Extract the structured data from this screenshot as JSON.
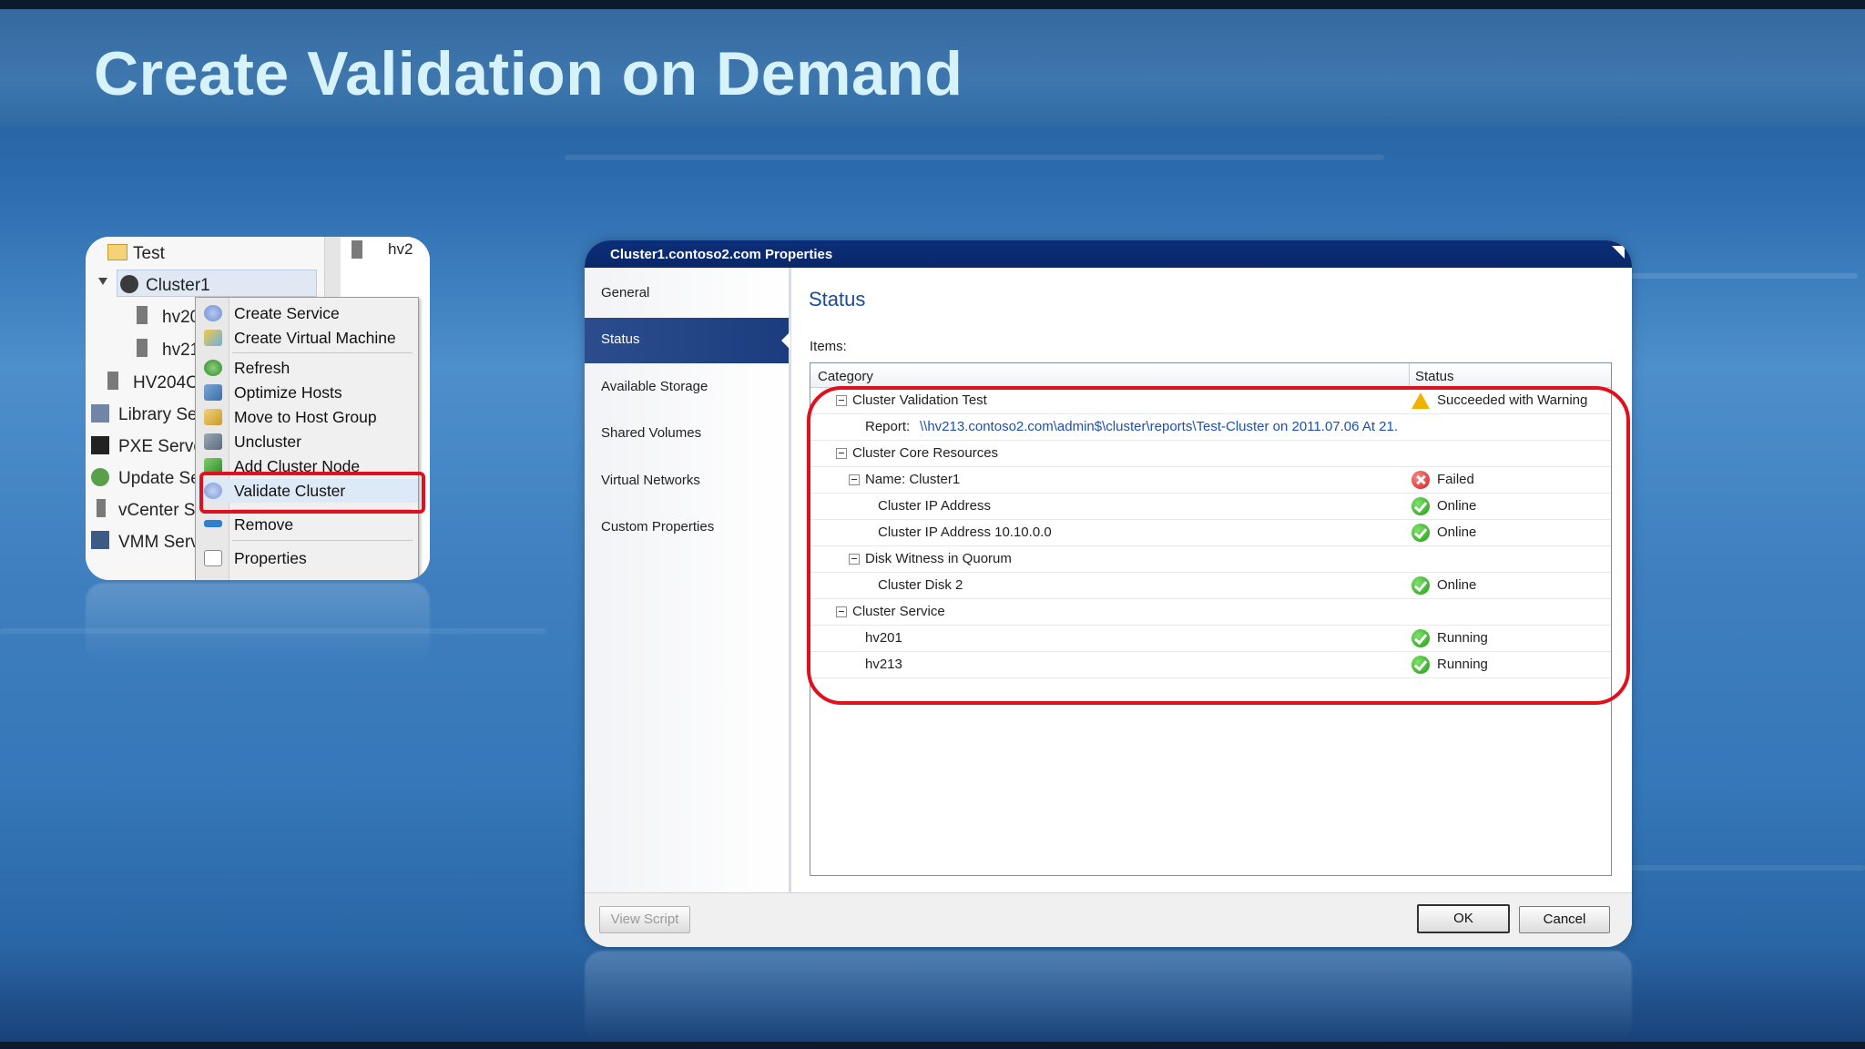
{
  "slide": {
    "title": "Create Validation on Demand"
  },
  "tree": {
    "items": [
      {
        "label": "Test"
      },
      {
        "label": "Cluster1"
      },
      {
        "label": "hv20"
      },
      {
        "label": "hv21"
      },
      {
        "label": "HV204C"
      },
      {
        "label": "Library Se"
      },
      {
        "label": "PXE Serve"
      },
      {
        "label": "Update Se"
      },
      {
        "label": "vCenter Se"
      },
      {
        "label": "VMM Serv"
      }
    ],
    "right_col_label": "hv2"
  },
  "context_menu": {
    "items": [
      {
        "label": "Create Service"
      },
      {
        "label": "Create Virtual Machine"
      },
      {
        "label": "Refresh"
      },
      {
        "label": "Optimize Hosts"
      },
      {
        "label": "Move to Host Group"
      },
      {
        "label": "Uncluster"
      },
      {
        "label": "Add Cluster Node"
      },
      {
        "label": "Validate Cluster"
      },
      {
        "label": "Remove"
      },
      {
        "label": "Properties"
      }
    ]
  },
  "dialog": {
    "title": "Cluster1.contoso2.com Properties",
    "nav": [
      {
        "label": "General"
      },
      {
        "label": "Status"
      },
      {
        "label": "Available Storage"
      },
      {
        "label": "Shared Volumes"
      },
      {
        "label": "Virtual Networks"
      },
      {
        "label": "Custom Properties"
      }
    ],
    "selected_nav": "Status",
    "heading": "Status",
    "items_label": "Items:",
    "columns": {
      "category": "Category",
      "status": "Status"
    },
    "rows": [
      {
        "category": "Cluster Validation Test",
        "status": "Succeeded with Warning",
        "icon": "warning-icon"
      },
      {
        "category": "Report:",
        "link": "\\\\hv213.contoso2.com\\admin$\\cluster\\reports\\Test-Cluster on 2011.07.06 At 21."
      },
      {
        "category": "Cluster Core Resources"
      },
      {
        "category": "Name: Cluster1",
        "status": "Failed",
        "icon": "error-icon"
      },
      {
        "category": "Cluster IP Address",
        "status": "Online",
        "icon": "check-icon"
      },
      {
        "category": "Cluster IP Address 10.10.0.0",
        "status": "Online",
        "icon": "check-icon"
      },
      {
        "category": "Disk Witness in Quorum"
      },
      {
        "category": "Cluster Disk 2",
        "status": "Online",
        "icon": "check-icon"
      },
      {
        "category": "Cluster Service"
      },
      {
        "category": "hv201",
        "status": "Running",
        "icon": "check-icon"
      },
      {
        "category": "hv213",
        "status": "Running",
        "icon": "check-icon"
      }
    ],
    "buttons": {
      "view_script": "View Script",
      "ok": "OK",
      "cancel": "Cancel"
    }
  },
  "colors": {
    "highlight_red": "#e0101e",
    "title_text": "#d6f2fb",
    "dialog_titlebar": "#0c2f7a",
    "nav_selected": "#2c4d8d"
  }
}
